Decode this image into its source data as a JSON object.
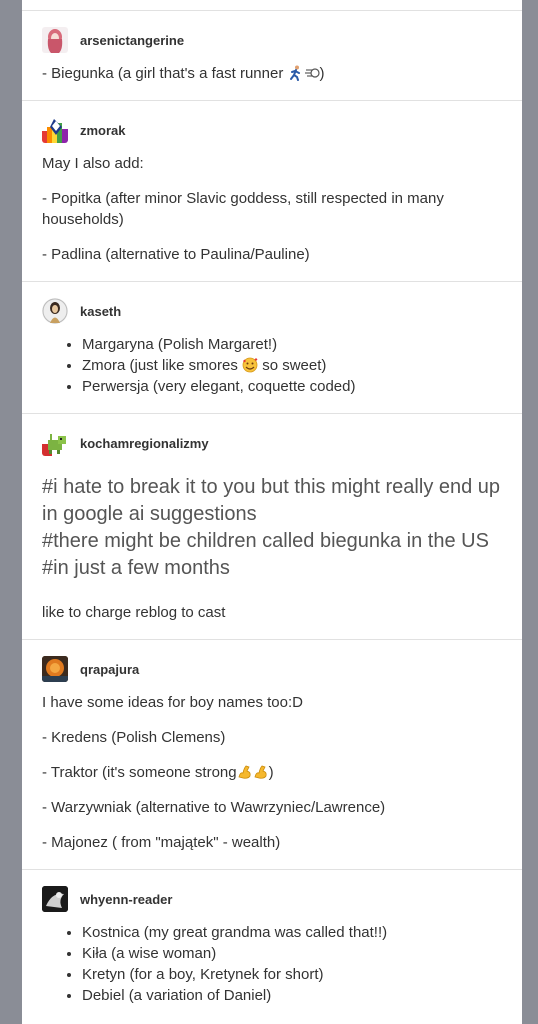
{
  "posts": [
    {
      "username": "arsenictangerine",
      "paragraphs": [
        "- Biegunka (a girl that's a fast runner",
        ")"
      ]
    },
    {
      "username": "zmorak",
      "paragraphs": [
        "May I also add:",
        "- Popitka (after minor Slavic goddess, still respected in many households)",
        "- Padlina (alternative to Paulina/Pauline)"
      ]
    },
    {
      "username": "kaseth",
      "items": [
        "Margaryna (Polish Margaret!)",
        "Zmora (just like smores",
        "so sweet)",
        "Perwersja (very elegant, coquette coded)"
      ]
    },
    {
      "username": "kochamregionalizmy",
      "tags": [
        "#i hate to break it to you but this might really end up in google ai suggestions",
        "#there might be children called biegunka in the US",
        "#in just a few months"
      ],
      "footer": "like to charge reblog to cast"
    },
    {
      "username": "qrapajura",
      "paragraphs": [
        "I have some ideas for boy names too:D",
        "- Kredens (Polish Clemens)",
        "- Traktor (it's someone strong",
        ")",
        "- Warzywniak (alternative to Wawrzyniec/Lawrence)",
        "- Majonez ( from \"majątek\" - wealth)"
      ]
    },
    {
      "username": "whyenn-reader",
      "items": [
        "Kostnica (my great grandma was called that!!)",
        "Kiła (a wise woman)",
        "Kretyn (for a boy, Kretynek for short)",
        "Debiel (a variation of Daniel)"
      ]
    }
  ],
  "icons": {
    "runner": "runner-emoji",
    "dash": "dash-emoji",
    "hearts_face": "smiling-face-with-hearts-emoji",
    "muscle": "flexed-biceps-emoji"
  }
}
